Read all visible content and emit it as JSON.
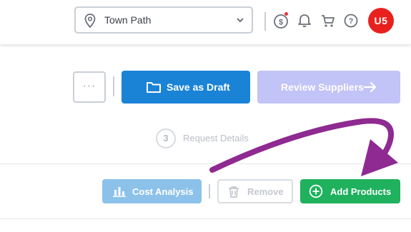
{
  "header": {
    "location": {
      "value": "Town Path",
      "icon": "map-pin-icon"
    },
    "icons": [
      "currency-exchange-icon",
      "bell-icon",
      "cart-icon",
      "help-icon"
    ],
    "avatar_initials": "U5",
    "avatar_color": "#e8211e"
  },
  "actions": {
    "more_label": "···",
    "save_draft_label": "Save as Draft",
    "review_label": "Review Suppliers"
  },
  "step": {
    "number": "3",
    "label": "Request Details"
  },
  "toolbar": {
    "cost_analysis_label": "Cost Analysis",
    "remove_label": "Remove",
    "add_products_label": "Add Products"
  },
  "colors": {
    "primary": "#1a83d6",
    "disabled_primary": "#c2c3f6",
    "success": "#1fb15d",
    "annotation": "#8e2a91"
  }
}
